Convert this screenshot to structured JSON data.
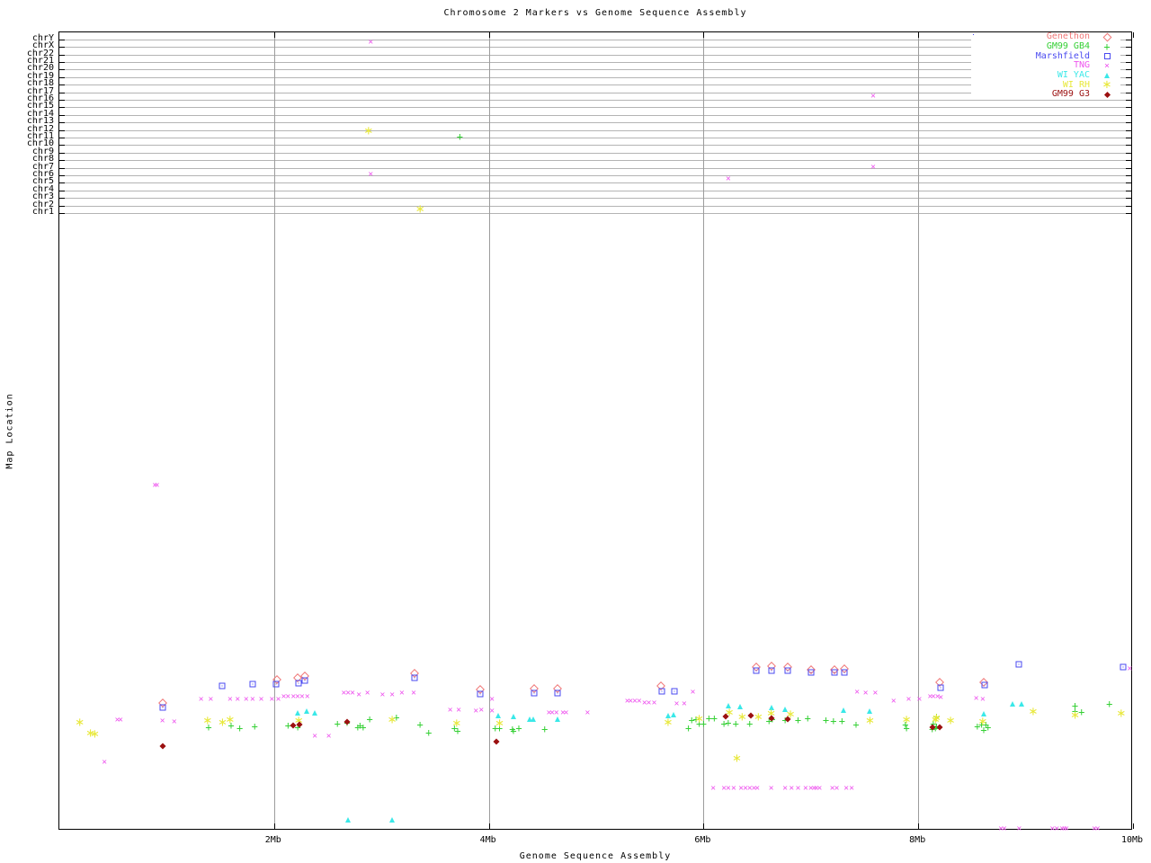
{
  "chart_data": {
    "type": "scatter",
    "title": "Chromosome 2 Markers vs Genome Sequence Assembly",
    "xlabel": "Genome Sequence Assembly",
    "ylabel": "Map Location",
    "x_range_mb": [
      0,
      10
    ],
    "x_ticks": [
      {
        "label": "2Mb",
        "mb": 2
      },
      {
        "label": "4Mb",
        "mb": 4
      },
      {
        "label": "6Mb",
        "mb": 6
      },
      {
        "label": "8Mb",
        "mb": 8
      },
      {
        "label": "10Mb",
        "mb": 10
      }
    ],
    "y_categories": [
      "chrY",
      "chrX",
      "chr22",
      "chr21",
      "chr20",
      "chr19",
      "chr18",
      "chr17",
      "chr16",
      "chr15",
      "chr14",
      "chr13",
      "chr12",
      "chr11",
      "chr10",
      "chr9",
      "chr8",
      "chr7",
      "chr6",
      "chr5",
      "chr4",
      "chr3",
      "chr2",
      "chr1"
    ],
    "grid": {
      "vertical_at_mb": [
        2,
        4,
        6,
        8
      ],
      "horizontal": "one gray line per chromosome tick"
    },
    "legend_position": "top-right",
    "point_format": "[x_in_Mb, y_fraction_of_plot_height_from_top]",
    "series": [
      {
        "name": "Genethon",
        "color": "#f07878",
        "marker": "open-diamond",
        "points": [
          [
            0.96,
            0.84
          ],
          [
            2.03,
            0.811
          ],
          [
            2.22,
            0.808
          ],
          [
            2.29,
            0.806
          ],
          [
            3.31,
            0.803
          ],
          [
            3.92,
            0.823
          ],
          [
            4.42,
            0.822
          ],
          [
            4.64,
            0.822
          ],
          [
            5.6,
            0.819
          ],
          [
            6.49,
            0.795
          ],
          [
            6.63,
            0.794
          ],
          [
            6.78,
            0.795
          ],
          [
            7.0,
            0.798
          ],
          [
            7.22,
            0.798
          ],
          [
            7.31,
            0.797
          ],
          [
            8.2,
            0.814
          ],
          [
            8.61,
            0.814
          ]
        ]
      },
      {
        "name": "GM99 GB4",
        "color": "#35d035",
        "marker": "plus",
        "points": [
          [
            3.73,
            0.131
          ],
          [
            1.39,
            0.87
          ],
          [
            1.6,
            0.868
          ],
          [
            1.68,
            0.872
          ],
          [
            1.82,
            0.869
          ],
          [
            2.13,
            0.868
          ],
          [
            2.22,
            0.871
          ],
          [
            2.59,
            0.866
          ],
          [
            2.68,
            0.865
          ],
          [
            2.78,
            0.87
          ],
          [
            2.8,
            0.868
          ],
          [
            2.83,
            0.87
          ],
          [
            2.89,
            0.86
          ],
          [
            3.14,
            0.858
          ],
          [
            3.36,
            0.867
          ],
          [
            3.44,
            0.877
          ],
          [
            3.68,
            0.872
          ],
          [
            3.71,
            0.875
          ],
          [
            4.06,
            0.872
          ],
          [
            4.1,
            0.872
          ],
          [
            4.22,
            0.873
          ],
          [
            4.23,
            0.875
          ],
          [
            4.28,
            0.872
          ],
          [
            4.52,
            0.873
          ],
          [
            5.86,
            0.872
          ],
          [
            5.89,
            0.861
          ],
          [
            5.93,
            0.86
          ],
          [
            5.96,
            0.866
          ],
          [
            6.0,
            0.866
          ],
          [
            6.05,
            0.859
          ],
          [
            6.1,
            0.859
          ],
          [
            6.19,
            0.866
          ],
          [
            6.23,
            0.865
          ],
          [
            6.3,
            0.866
          ],
          [
            6.43,
            0.866
          ],
          [
            6.61,
            0.863
          ],
          [
            6.64,
            0.86
          ],
          [
            6.76,
            0.861
          ],
          [
            6.88,
            0.861
          ],
          [
            6.97,
            0.859
          ],
          [
            7.14,
            0.861
          ],
          [
            7.21,
            0.863
          ],
          [
            7.29,
            0.863
          ],
          [
            7.42,
            0.867
          ],
          [
            7.88,
            0.867
          ],
          [
            7.89,
            0.872
          ],
          [
            8.13,
            0.873
          ],
          [
            8.14,
            0.866
          ],
          [
            8.16,
            0.872
          ],
          [
            8.17,
            0.869
          ],
          [
            8.17,
            0.857
          ],
          [
            8.55,
            0.869
          ],
          [
            8.59,
            0.867
          ],
          [
            8.63,
            0.867
          ],
          [
            8.65,
            0.87
          ],
          [
            8.61,
            0.874
          ],
          [
            9.46,
            0.844
          ],
          [
            9.46,
            0.85
          ],
          [
            9.52,
            0.851
          ],
          [
            9.78,
            0.841
          ]
        ]
      },
      {
        "name": "Marshfield",
        "color": "#4a4af0",
        "marker": "square-dot",
        "points": [
          [
            0.96,
            0.846
          ],
          [
            1.52,
            0.819
          ],
          [
            1.8,
            0.817
          ],
          [
            2.02,
            0.816
          ],
          [
            2.23,
            0.815
          ],
          [
            2.29,
            0.812
          ],
          [
            3.31,
            0.808
          ],
          [
            3.92,
            0.829
          ],
          [
            4.42,
            0.828
          ],
          [
            4.64,
            0.828
          ],
          [
            5.61,
            0.826
          ],
          [
            5.73,
            0.825
          ],
          [
            6.49,
            0.8
          ],
          [
            6.63,
            0.799
          ],
          [
            6.78,
            0.8
          ],
          [
            7.0,
            0.802
          ],
          [
            7.22,
            0.802
          ],
          [
            7.31,
            0.802
          ],
          [
            8.21,
            0.821
          ],
          [
            8.62,
            0.818
          ],
          [
            8.94,
            0.792
          ],
          [
            9.91,
            0.795
          ]
        ]
      },
      {
        "name": "TNG",
        "color": "#ee55ee",
        "marker": "cross",
        "points": [
          [
            2.9,
            0.012
          ],
          [
            7.58,
            0.08
          ],
          [
            7.58,
            0.169
          ],
          [
            6.23,
            0.183
          ],
          [
            2.9,
            0.178
          ],
          [
            0.89,
            0.568
          ],
          [
            0.91,
            0.568
          ],
          [
            0.42,
            0.914
          ],
          [
            0.54,
            0.862
          ],
          [
            0.57,
            0.862
          ],
          [
            0.96,
            0.863
          ],
          [
            1.07,
            0.864
          ],
          [
            1.32,
            0.836
          ],
          [
            1.41,
            0.836
          ],
          [
            1.59,
            0.836
          ],
          [
            1.66,
            0.836
          ],
          [
            1.74,
            0.836
          ],
          [
            1.8,
            0.836
          ],
          [
            1.88,
            0.836
          ],
          [
            1.98,
            0.836
          ],
          [
            2.04,
            0.836
          ],
          [
            2.09,
            0.832
          ],
          [
            2.13,
            0.832
          ],
          [
            2.18,
            0.832
          ],
          [
            2.22,
            0.832
          ],
          [
            2.26,
            0.832
          ],
          [
            2.31,
            0.832
          ],
          [
            2.38,
            0.882
          ],
          [
            2.51,
            0.882
          ],
          [
            2.65,
            0.828
          ],
          [
            2.69,
            0.828
          ],
          [
            2.73,
            0.828
          ],
          [
            2.79,
            0.83
          ],
          [
            2.87,
            0.828
          ],
          [
            3.01,
            0.83
          ],
          [
            3.1,
            0.83
          ],
          [
            3.19,
            0.828
          ],
          [
            3.3,
            0.828
          ],
          [
            3.64,
            0.849
          ],
          [
            3.72,
            0.849
          ],
          [
            3.88,
            0.85
          ],
          [
            3.93,
            0.849
          ],
          [
            4.03,
            0.836
          ],
          [
            4.03,
            0.85
          ],
          [
            4.56,
            0.852
          ],
          [
            4.59,
            0.852
          ],
          [
            4.63,
            0.852
          ],
          [
            4.69,
            0.852
          ],
          [
            4.72,
            0.852
          ],
          [
            4.92,
            0.852
          ],
          [
            5.29,
            0.838
          ],
          [
            5.32,
            0.838
          ],
          [
            5.36,
            0.838
          ],
          [
            5.4,
            0.838
          ],
          [
            5.45,
            0.84
          ],
          [
            5.49,
            0.84
          ],
          [
            5.54,
            0.84
          ],
          [
            5.75,
            0.841
          ],
          [
            5.82,
            0.841
          ],
          [
            5.9,
            0.827
          ],
          [
            7.43,
            0.827
          ],
          [
            7.51,
            0.828
          ],
          [
            7.6,
            0.828
          ],
          [
            7.77,
            0.838
          ],
          [
            7.91,
            0.836
          ],
          [
            8.01,
            0.836
          ],
          [
            8.11,
            0.832
          ],
          [
            8.14,
            0.832
          ],
          [
            8.18,
            0.832
          ],
          [
            8.21,
            0.833
          ],
          [
            8.54,
            0.835
          ],
          [
            8.6,
            0.836
          ],
          [
            9.97,
            0.797
          ],
          [
            6.09,
            0.947
          ],
          [
            6.19,
            0.947
          ],
          [
            6.23,
            0.947
          ],
          [
            6.28,
            0.947
          ],
          [
            6.35,
            0.947
          ],
          [
            6.39,
            0.947
          ],
          [
            6.43,
            0.947
          ],
          [
            6.47,
            0.947
          ],
          [
            6.5,
            0.947
          ],
          [
            6.63,
            0.947
          ],
          [
            6.76,
            0.947
          ],
          [
            6.82,
            0.947
          ],
          [
            6.88,
            0.947
          ],
          [
            6.95,
            0.947
          ],
          [
            7.0,
            0.947
          ],
          [
            7.03,
            0.947
          ],
          [
            7.05,
            0.947
          ],
          [
            7.08,
            0.947
          ],
          [
            7.2,
            0.947
          ],
          [
            7.24,
            0.947
          ],
          [
            7.33,
            0.947
          ],
          [
            7.38,
            0.947
          ],
          [
            8.77,
            0.998
          ],
          [
            8.8,
            0.998
          ],
          [
            8.94,
            0.998
          ],
          [
            9.25,
            0.998
          ],
          [
            9.29,
            0.998
          ],
          [
            9.34,
            0.998
          ],
          [
            9.36,
            0.998
          ],
          [
            9.38,
            0.998
          ],
          [
            9.64,
            0.998
          ],
          [
            9.67,
            0.998
          ]
        ]
      },
      {
        "name": "WI YAC",
        "color": "#3ae8e8",
        "marker": "triangle",
        "points": [
          [
            2.22,
            0.852
          ],
          [
            2.3,
            0.85
          ],
          [
            2.38,
            0.852
          ],
          [
            2.69,
            0.986
          ],
          [
            3.1,
            0.987
          ],
          [
            4.09,
            0.856
          ],
          [
            4.23,
            0.857
          ],
          [
            4.38,
            0.86
          ],
          [
            4.41,
            0.86
          ],
          [
            4.64,
            0.86
          ],
          [
            5.67,
            0.856
          ],
          [
            5.72,
            0.855
          ],
          [
            6.23,
            0.843
          ],
          [
            6.34,
            0.845
          ],
          [
            6.63,
            0.846
          ],
          [
            6.76,
            0.848
          ],
          [
            7.3,
            0.849
          ],
          [
            7.55,
            0.85
          ],
          [
            8.61,
            0.854
          ],
          [
            8.88,
            0.841
          ],
          [
            8.96,
            0.841
          ]
        ]
      },
      {
        "name": "WI RH",
        "color": "#e8e83a",
        "marker": "asterisk",
        "points": [
          [
            2.88,
            0.124
          ],
          [
            3.36,
            0.222
          ],
          [
            0.19,
            0.865
          ],
          [
            0.29,
            0.878
          ],
          [
            0.33,
            0.88
          ],
          [
            1.38,
            0.863
          ],
          [
            1.52,
            0.865
          ],
          [
            1.59,
            0.861
          ],
          [
            2.23,
            0.863
          ],
          [
            3.1,
            0.862
          ],
          [
            3.7,
            0.866
          ],
          [
            4.1,
            0.866
          ],
          [
            5.67,
            0.865
          ],
          [
            5.96,
            0.86
          ],
          [
            6.24,
            0.853
          ],
          [
            6.36,
            0.858
          ],
          [
            6.51,
            0.858
          ],
          [
            6.63,
            0.854
          ],
          [
            6.81,
            0.855
          ],
          [
            6.31,
            0.91
          ],
          [
            7.55,
            0.863
          ],
          [
            7.89,
            0.862
          ],
          [
            8.16,
            0.862
          ],
          [
            8.17,
            0.859
          ],
          [
            8.3,
            0.863
          ],
          [
            8.6,
            0.864
          ],
          [
            9.07,
            0.851
          ],
          [
            9.46,
            0.856
          ],
          [
            9.89,
            0.854
          ]
        ]
      },
      {
        "name": "GM99 G3",
        "color": "#9b1010",
        "marker": "filled-diamond",
        "points": [
          [
            0.96,
            0.894
          ],
          [
            2.18,
            0.868
          ],
          [
            2.24,
            0.867
          ],
          [
            2.68,
            0.864
          ],
          [
            4.07,
            0.889
          ],
          [
            6.21,
            0.857
          ],
          [
            6.44,
            0.856
          ],
          [
            6.63,
            0.859
          ],
          [
            6.78,
            0.86
          ],
          [
            8.13,
            0.87
          ],
          [
            8.2,
            0.87
          ]
        ]
      }
    ]
  }
}
